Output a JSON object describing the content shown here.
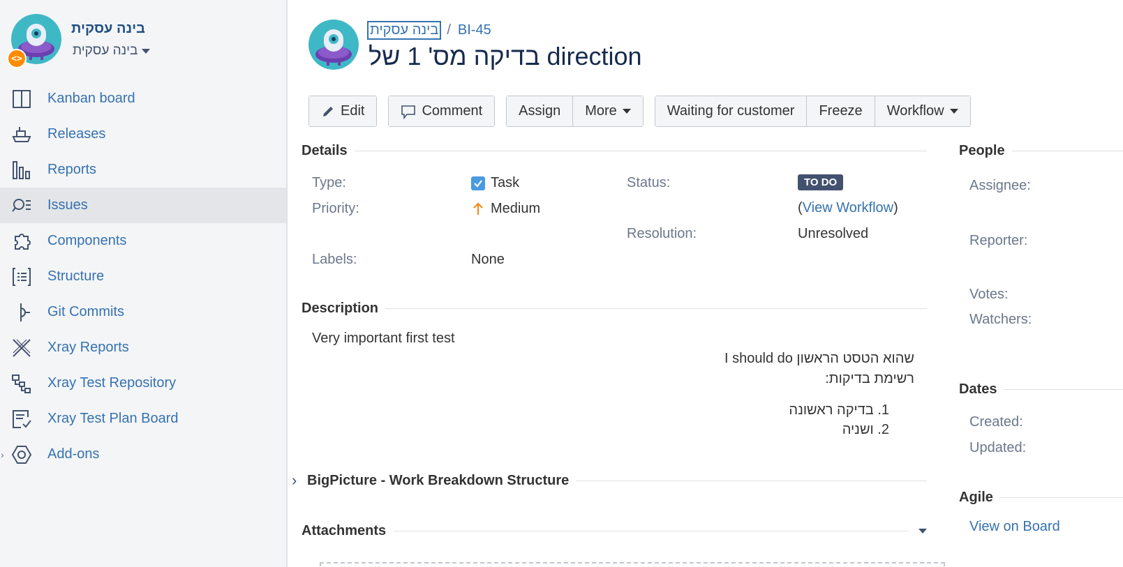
{
  "project": {
    "name": "בינה עסקית",
    "subtitle": "בינה עסקית",
    "badge": "<>"
  },
  "nav": {
    "items": [
      {
        "label": "Kanban board",
        "icon": "kanban-board-icon"
      },
      {
        "label": "Releases",
        "icon": "ship-icon"
      },
      {
        "label": "Reports",
        "icon": "bar-chart-icon"
      },
      {
        "label": "Issues",
        "icon": "search-list-icon",
        "active": true
      },
      {
        "label": "Components",
        "icon": "puzzle-icon"
      },
      {
        "label": "Structure",
        "icon": "structure-icon"
      },
      {
        "label": "Git Commits",
        "icon": "git-commit-icon"
      },
      {
        "label": "Xray Reports",
        "icon": "xray-icon"
      },
      {
        "label": "Xray Test Repository",
        "icon": "repository-icon"
      },
      {
        "label": "Xray Test Plan Board",
        "icon": "plan-board-icon"
      },
      {
        "label": "Add-ons",
        "icon": "hexagon-icon"
      }
    ],
    "expand_glyph": "›"
  },
  "issue": {
    "breadcrumb_project": "בינה עסקית",
    "breadcrumb_sep": "/",
    "key": "BI-45",
    "title": "בדיקה מס' 1 של direction"
  },
  "toolbar": {
    "edit": "Edit",
    "comment": "Comment",
    "assign": "Assign",
    "more": "More",
    "waiting": "Waiting for customer",
    "freeze": "Freeze",
    "workflow": "Workflow"
  },
  "details": {
    "heading": "Details",
    "type_label": "Type:",
    "type_value": "Task",
    "priority_label": "Priority:",
    "priority_value": "Medium",
    "labels_label": "Labels:",
    "labels_value": "None",
    "status_label": "Status:",
    "status_value": "TO DO",
    "view_workflow_open": "(",
    "view_workflow": "View Workflow",
    "view_workflow_close": ")",
    "resolution_label": "Resolution:",
    "resolution_value": "Unresolved"
  },
  "description": {
    "heading": "Description",
    "line1": "Very important first test",
    "line2": "שהוא הטסט הראשון I should do",
    "line3": "רשימת בדיקות:",
    "item1": "1. בדיקה ראשונה",
    "item2": "2. ושניה"
  },
  "bigpicture": {
    "heading": "BigPicture - Work Breakdown Structure",
    "toggle": "›"
  },
  "attachments": {
    "heading": "Attachments"
  },
  "people": {
    "heading": "People",
    "assignee": "Assignee:",
    "reporter": "Reporter:",
    "votes": "Votes:",
    "watchers": "Watchers:"
  },
  "dates": {
    "heading": "Dates",
    "created": "Created:",
    "updated": "Updated:"
  },
  "agile": {
    "heading": "Agile",
    "view_on_board": "View on Board"
  },
  "colors": {
    "link": "#3572b0",
    "status_lozenge": "#42526e",
    "priority_arrow": "#f18a1f",
    "avatar_teal": "#3fb8c6",
    "avatar_purple": "#7b3fb7"
  }
}
